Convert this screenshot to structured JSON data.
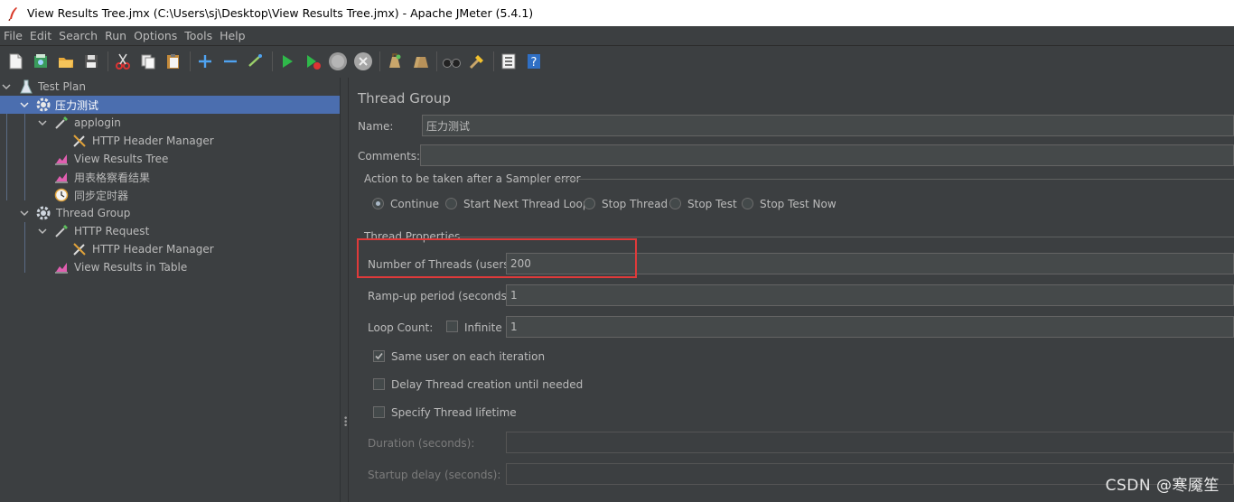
{
  "window": {
    "title": "View Results Tree.jmx (C:\\Users\\sj\\Desktop\\View Results Tree.jmx) - Apache JMeter (5.4.1)"
  },
  "menu": [
    "File",
    "Edit",
    "Search",
    "Run",
    "Options",
    "Tools",
    "Help"
  ],
  "toolbar": {
    "icons": [
      "new-icon",
      "templates-icon",
      "open-icon",
      "save-icon",
      "cut-icon",
      "copy-icon",
      "paste-icon",
      "expand-icon",
      "collapse-icon",
      "toggle-icon",
      "start-icon",
      "start-no-pauses-icon",
      "stop-icon",
      "shutdown-icon",
      "clear-icon",
      "clear-all-icon",
      "search-icon",
      "reset-search-icon",
      "function-helper-icon",
      "help-icon"
    ]
  },
  "tree": {
    "items": [
      {
        "label": "Test Plan",
        "icon": "test-plan-icon"
      },
      {
        "label": "压力测试",
        "icon": "thread-group-gear-icon"
      },
      {
        "label": "applogin",
        "icon": "sampler-pipette-icon"
      },
      {
        "label": "HTTP Header Manager",
        "icon": "config-wrench-icon"
      },
      {
        "label": "View Results Tree",
        "icon": "listener-graph-icon"
      },
      {
        "label": "用表格察看结果",
        "icon": "listener-graph-icon"
      },
      {
        "label": "同步定时器",
        "icon": "timer-clock-icon"
      },
      {
        "label": "Thread Group",
        "icon": "thread-group-gear-icon"
      },
      {
        "label": "HTTP Request",
        "icon": "sampler-pipette-icon"
      },
      {
        "label": "HTTP Header Manager",
        "icon": "config-wrench-icon"
      },
      {
        "label": "View Results in Table",
        "icon": "listener-graph-icon"
      }
    ]
  },
  "panel": {
    "title": "Thread Group",
    "name_label": "Name:",
    "name_value": "压力测试",
    "comments_label": "Comments:",
    "comments_value": "",
    "sampler_error": {
      "legend": "Action to be taken after a Sampler error",
      "options": [
        "Continue",
        "Start Next Thread Loop",
        "Stop Thread",
        "Stop Test",
        "Stop Test Now"
      ],
      "selected": "Continue"
    },
    "thread_props": {
      "legend": "Thread Properties",
      "threads_label": "Number of Threads (users):",
      "threads_value": "200",
      "rampup_label": "Ramp-up period (seconds):",
      "rampup_value": "1",
      "loop_label": "Loop Count:",
      "infinite_label": "Infinite",
      "loop_value": "1",
      "same_user_label": "Same user on each iteration",
      "same_user_checked": true,
      "delay_label": "Delay Thread creation until needed",
      "lifetime_label": "Specify Thread lifetime",
      "duration_label": "Duration (seconds):",
      "startup_label": "Startup delay (seconds):"
    }
  },
  "watermark": "CSDN @寒魇笙"
}
